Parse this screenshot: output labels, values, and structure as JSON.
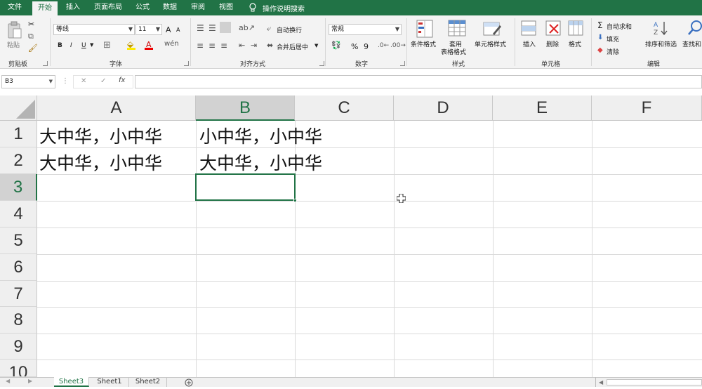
{
  "menu": {
    "tabs": [
      "文件",
      "开始",
      "插入",
      "页面布局",
      "公式",
      "数据",
      "审阅",
      "视图"
    ],
    "tell_me": "操作说明搜索"
  },
  "ribbon": {
    "clipboard": {
      "paste": "粘贴",
      "label": "剪贴板"
    },
    "font": {
      "name": "等线",
      "size": "11",
      "grow": "A",
      "shrink": "A",
      "bold": "B",
      "italic": "I",
      "underline": "U",
      "label": "字体"
    },
    "alignment": {
      "wrap": "自动换行",
      "merge": "合并后居中",
      "label": "对齐方式"
    },
    "number": {
      "format": "常规",
      "percent": "%",
      "comma": "9",
      "label": "数字"
    },
    "styles": {
      "conditional": "条件格式",
      "table_line1": "套用",
      "table_line2": "表格格式",
      "cell_styles": "单元格样式",
      "label": "样式"
    },
    "cells": {
      "insert": "插入",
      "delete": "删除",
      "format": "格式",
      "label": "单元格"
    },
    "editing": {
      "autosum": "自动求和",
      "fill": "填充",
      "clear": "清除",
      "sort": "排序和筛选",
      "find": "查找和",
      "label": "编辑"
    }
  },
  "formula_bar": {
    "name_box": "B3",
    "fx": "fx",
    "value": ""
  },
  "grid": {
    "columns": [
      "A",
      "B",
      "C",
      "D",
      "E",
      "F"
    ],
    "rows": [
      "1",
      "2",
      "3",
      "4",
      "5",
      "6",
      "7",
      "8",
      "9",
      "10"
    ],
    "cells": {
      "A1": "大中华，小中华",
      "B1": "小中华，小中华",
      "A2": "大中华，小中华",
      "B2": "大中华，小中华"
    },
    "selected_cell": "B3"
  },
  "sheets": [
    "Sheet3",
    "Sheet1",
    "Sheet2"
  ],
  "active_sheet": "Sheet3",
  "colors": {
    "accent": "#217346",
    "header_bg": "#efefef",
    "ribbon_bg": "#f3f3f3"
  }
}
